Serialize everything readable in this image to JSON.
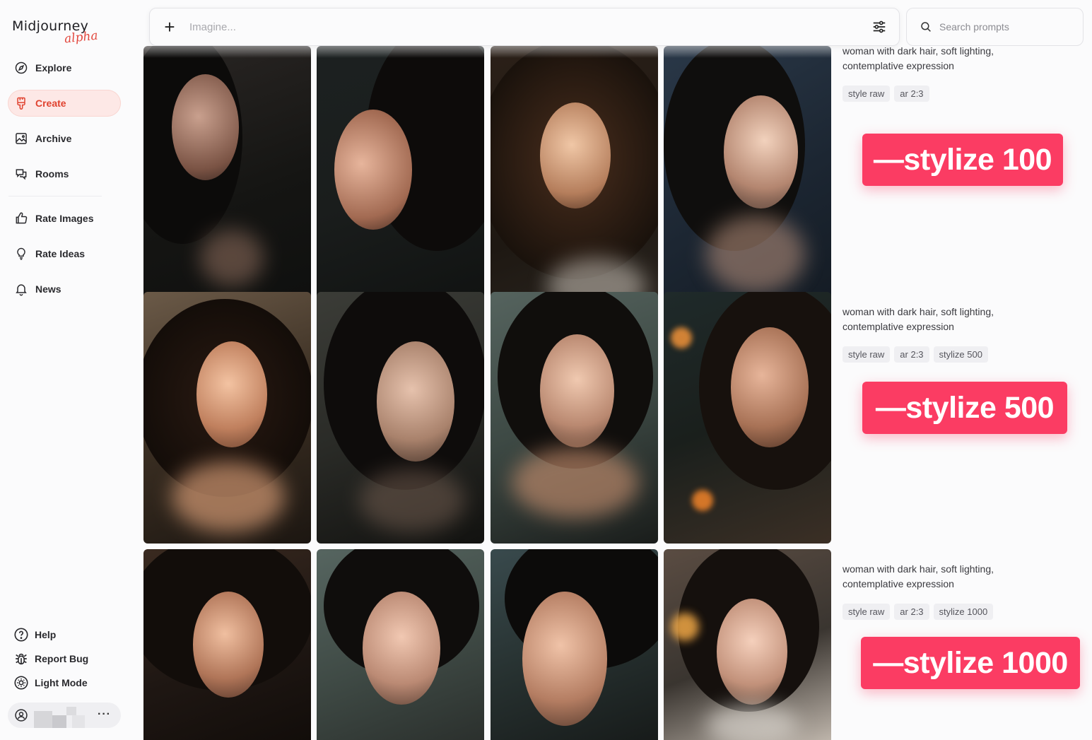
{
  "brand": {
    "name": "Midjourney",
    "tag": "alpha",
    "accent": "#e2473d"
  },
  "nav": [
    {
      "label": "Explore",
      "icon": "compass-icon",
      "active": false
    },
    {
      "label": "Create",
      "icon": "paintbrush-icon",
      "active": true
    },
    {
      "label": "Archive",
      "icon": "image-icon",
      "active": false
    },
    {
      "label": "Rooms",
      "icon": "chat-icon",
      "active": false
    },
    {
      "label": "Rate Images",
      "icon": "thumbs-up-icon",
      "active": false
    },
    {
      "label": "Rate Ideas",
      "icon": "lightbulb-icon",
      "active": false
    },
    {
      "label": "News",
      "icon": "bell-icon",
      "active": false
    }
  ],
  "footer": [
    {
      "label": "Help",
      "icon": "help-circle-icon"
    },
    {
      "label": "Report Bug",
      "icon": "bug-icon"
    },
    {
      "label": "Light Mode",
      "icon": "sun-icon"
    }
  ],
  "user": {
    "more_label": "···"
  },
  "imagine": {
    "placeholder": "Imagine..."
  },
  "search": {
    "placeholder": "Search prompts"
  },
  "rows": [
    {
      "prompt": "woman with dark hair, soft lighting, contemplative expression",
      "chips": [
        "style raw",
        "ar 2:3"
      ],
      "stamp": "—stylize 100"
    },
    {
      "prompt": "woman with dark hair, soft lighting, contemplative expression",
      "chips": [
        "style raw",
        "ar 2:3",
        "stylize 500"
      ],
      "stamp": "—stylize 500"
    },
    {
      "prompt": "woman with dark hair, soft lighting, contemplative expression",
      "chips": [
        "style raw",
        "ar 2:3",
        "stylize 1000"
      ],
      "stamp": "—stylize 1000"
    }
  ],
  "colors": {
    "stamp": "#fb3c63",
    "active_bg": "#fde8e6",
    "active_text": "#e0422f"
  }
}
